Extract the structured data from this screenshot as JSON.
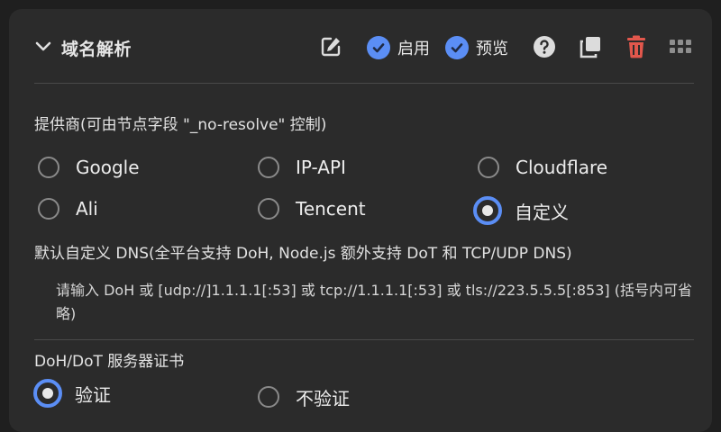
{
  "header": {
    "title": "域名解析",
    "enable_label": "启用",
    "preview_label": "预览"
  },
  "icons": [
    "chevron-down-icon",
    "edit-icon",
    "check-icon",
    "help-icon",
    "copy-icon",
    "trash-icon",
    "drag-handle-icon"
  ],
  "colors": {
    "panel_bg": "#2b2b2b",
    "accent": "#5b8ef5",
    "danger": "#e2574c"
  },
  "provider": {
    "label": "提供商(可由节点字段 \"_no-resolve\" 控制)",
    "options": [
      {
        "label": "Google",
        "selected": false
      },
      {
        "label": "IP-API",
        "selected": false
      },
      {
        "label": "Cloudflare",
        "selected": false
      },
      {
        "label": "Ali",
        "selected": false
      },
      {
        "label": "Tencent",
        "selected": false
      },
      {
        "label": "自定义",
        "selected": true
      }
    ]
  },
  "custom_dns": {
    "label": "默认自定义 DNS(全平台支持 DoH, Node.js 额外支持 DoT 和 TCP/UDP DNS)",
    "placeholder": "请输入 DoH 或 [udp://]1.1.1.1[:53] 或 tcp://1.1.1.1[:53] 或 tls://223.5.5.5[:853] (括号内可省略)"
  },
  "cert": {
    "label": "DoH/DoT 服务器证书",
    "options": [
      {
        "label": "验证",
        "selected": true
      },
      {
        "label": "不验证",
        "selected": false
      }
    ]
  }
}
